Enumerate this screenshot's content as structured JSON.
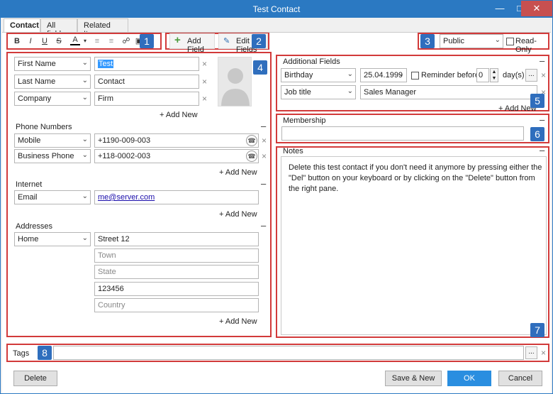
{
  "window": {
    "title": "Test Contact"
  },
  "tabs": [
    {
      "label": "Contact"
    },
    {
      "label": "All fields"
    },
    {
      "label": "Related Items"
    }
  ],
  "toolbar": {
    "add_field": "Add Field",
    "edit_fields": "Edit Fields",
    "visibility": "Public",
    "read_only": "Read-Only"
  },
  "badges": [
    "1",
    "2",
    "3",
    "4",
    "5",
    "6",
    "7",
    "8"
  ],
  "name_fields": [
    {
      "type": "First Name",
      "value": "Test"
    },
    {
      "type": "Last Name",
      "value": "Contact"
    },
    {
      "type": "Company",
      "value": "Firm"
    }
  ],
  "phone": {
    "section": "Phone Numbers",
    "items": [
      {
        "type": "Mobile",
        "value": "+1190-009-003"
      },
      {
        "type": "Business Phone",
        "value": "+118-0002-003"
      }
    ]
  },
  "internet": {
    "section": "Internet",
    "type": "Email",
    "value": "me@server.com"
  },
  "addresses": {
    "section": "Addresses",
    "type": "Home",
    "street": "Street 12",
    "town": "Town",
    "state": "State",
    "zip": "123456",
    "country": "Country"
  },
  "add_new": "+ Add New",
  "additional": {
    "section": "Additional Fields",
    "birthday_label": "Birthday",
    "birthday_value": "25.04.1999",
    "reminder_label": "Reminder before",
    "reminder_value": "0",
    "days_label": "day(s)",
    "job_label": "Job title",
    "job_value": "Sales Manager"
  },
  "membership": {
    "section": "Membership"
  },
  "notes": {
    "section": "Notes",
    "line1": "Delete this test contact if you don't need it anymore by pressing either the",
    "line2": "\"Del\" button on your keyboard or by clicking on the \"Delete\" button from",
    "line3": "the right pane."
  },
  "tags": {
    "label": "Tags"
  },
  "footer": {
    "delete": "Delete",
    "save_new": "Save & New",
    "ok": "OK",
    "cancel": "Cancel"
  },
  "colors": {
    "title_bar": "#2b79c2",
    "highlight": "#d23a3a",
    "badge": "#2f6ebd",
    "ok_button": "#2a8ee0"
  }
}
